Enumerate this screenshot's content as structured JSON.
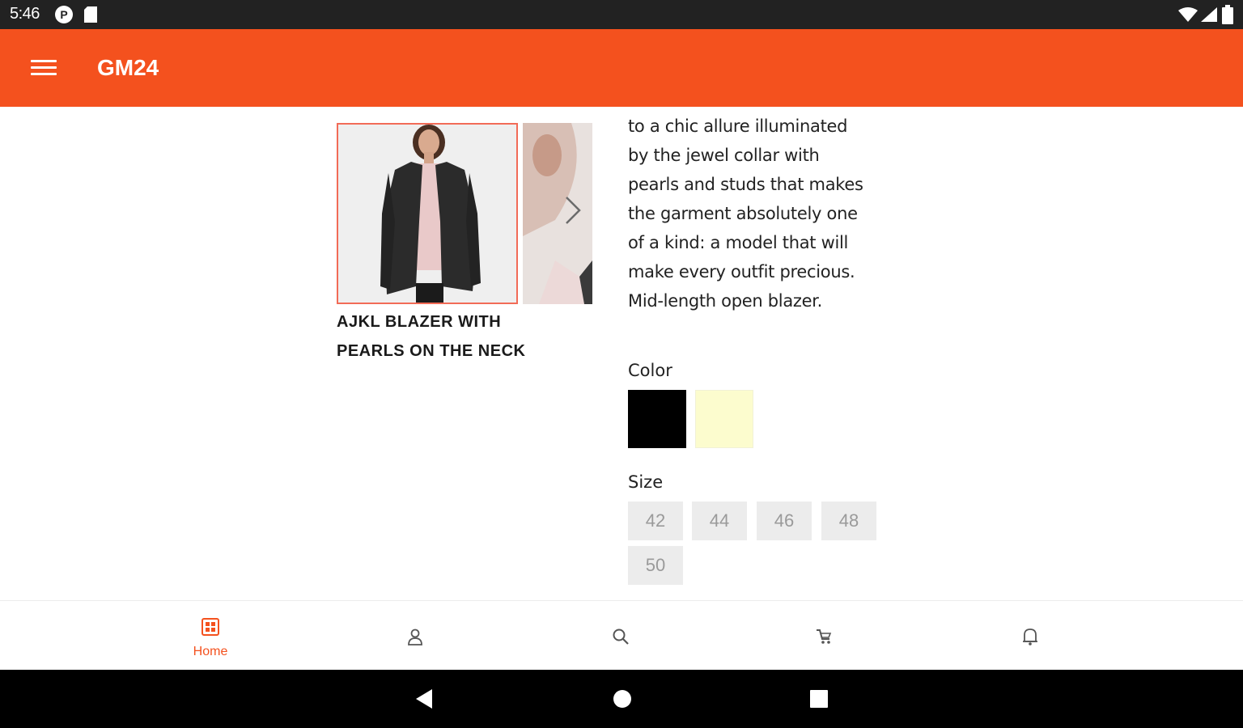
{
  "status_bar": {
    "time": "5:46",
    "p_badge": "P"
  },
  "app_bar": {
    "title": "GM24"
  },
  "product": {
    "name_line1": "AJKL BLAZER WITH",
    "name_line2": "PEARLS ON THE NECK",
    "description_lines": [
      "to a chic allure illuminated",
      "by the jewel collar with",
      "pearls and studs that makes",
      "the garment absolutely one",
      "of a kind: a model that will",
      "make every outfit precious.",
      "Mid-length open blazer."
    ]
  },
  "color_section": {
    "label": "Color",
    "swatches": [
      {
        "name": "black",
        "hex": "#000000"
      },
      {
        "name": "cream",
        "hex": "#fcfcce"
      }
    ]
  },
  "size_section": {
    "label": "Size",
    "sizes": [
      "42",
      "44",
      "46",
      "48",
      "50"
    ]
  },
  "bottom_nav": {
    "items": [
      {
        "label": "Home",
        "icon": "home-icon",
        "active": true
      },
      {
        "label": "",
        "icon": "person-icon",
        "active": false
      },
      {
        "label": "",
        "icon": "search-icon",
        "active": false
      },
      {
        "label": "",
        "icon": "cart-icon",
        "active": false
      },
      {
        "label": "",
        "icon": "bell-icon",
        "active": false
      }
    ]
  },
  "colors": {
    "accent": "#f4511e",
    "thumb_border": "#f26b57",
    "status_bar": "#222222",
    "nav_inactive": "#555555"
  }
}
